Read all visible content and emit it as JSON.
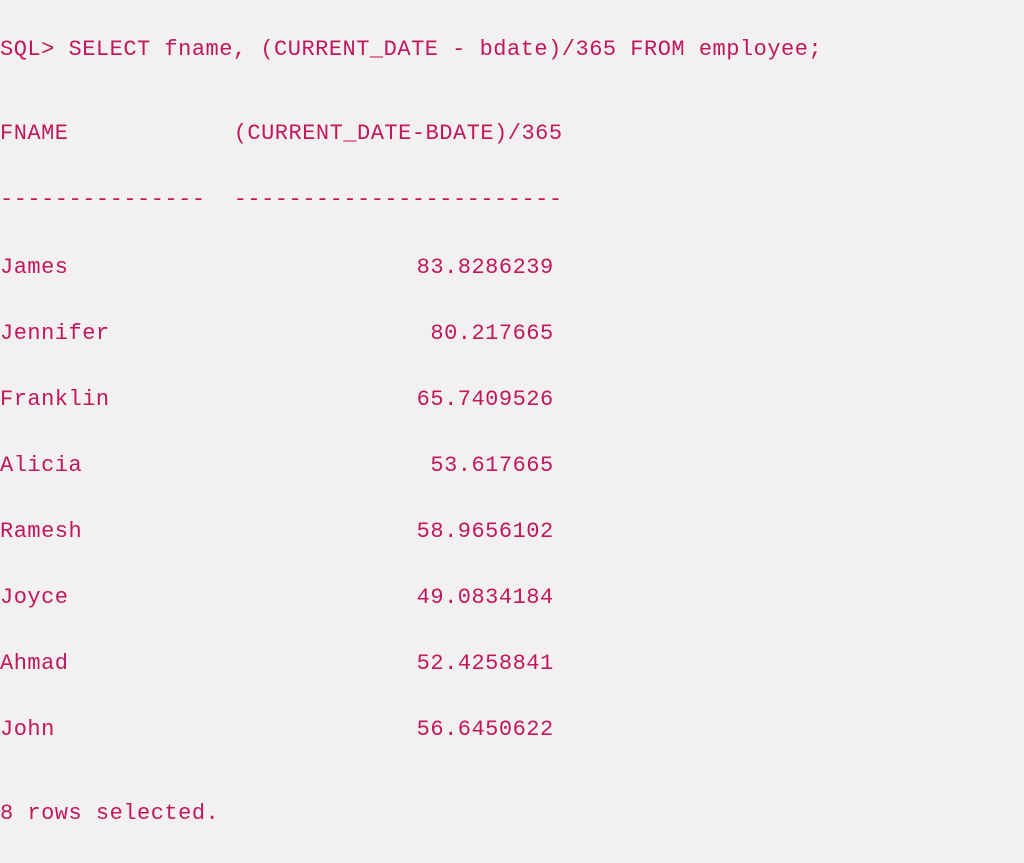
{
  "prompt": "SQL>",
  "query": "SELECT fname, (CURRENT_DATE - bdate)/365 FROM employee;",
  "headers": {
    "col1": "FNAME",
    "col2": "(CURRENT_DATE-BDATE)/365"
  },
  "divider": {
    "col1": "---------------",
    "col2": "------------------------"
  },
  "rows": [
    {
      "fname": "James",
      "value": "83.8286239"
    },
    {
      "fname": "Jennifer",
      "value": "80.217665"
    },
    {
      "fname": "Franklin",
      "value": "65.7409526"
    },
    {
      "fname": "Alicia",
      "value": "53.617665"
    },
    {
      "fname": "Ramesh",
      "value": "58.9656102"
    },
    {
      "fname": "Joyce",
      "value": "49.0834184"
    },
    {
      "fname": "Ahmad",
      "value": "52.4258841"
    },
    {
      "fname": "John",
      "value": "56.6450622"
    }
  ],
  "footer": "8 rows selected."
}
